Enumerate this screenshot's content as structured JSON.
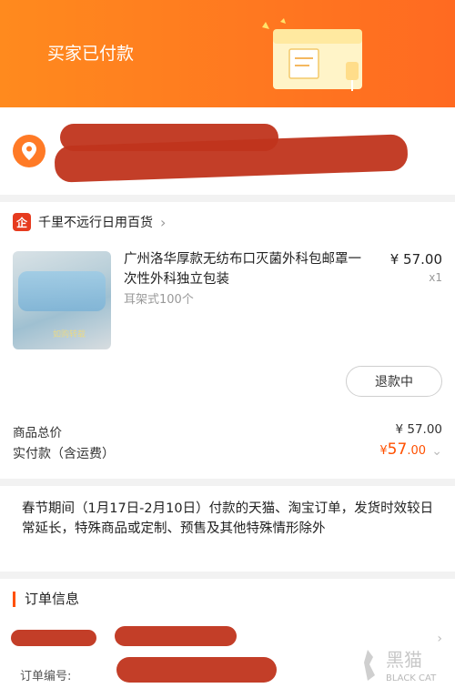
{
  "header": {
    "status_title": "买家已付款"
  },
  "shop": {
    "name": "千里不远行日用百货",
    "icon_text": "企"
  },
  "item": {
    "name": "广州洛华厚款无纺布口灭菌外科包邮罩一次性外科独立包装",
    "sku": "耳架式100个",
    "price": "¥ 57.00",
    "quantity": "x1",
    "thumbnail_watermark": "如购转载",
    "refund_button": "退款中"
  },
  "summary": {
    "goods_total_label": "商品总价",
    "goods_total_value": "¥ 57.00",
    "paid_label": "实付款（含运费）",
    "paid_currency": "¥",
    "paid_integer": "57",
    "paid_decimal": ".00"
  },
  "notice": "春节期间（1月17日-2月10日）付款的天猫、淘宝订单，发货时效较日常延长，特殊商品或定制、预售及其他特殊情形除外",
  "order": {
    "title": "订单信息",
    "order_no_label": "订单编号:"
  },
  "watermark": {
    "brand_cn": "黑猫",
    "brand_en": "BLACK CAT"
  },
  "colors": {
    "accent": "#ff5000",
    "header_start": "#ff8a1e",
    "header_end": "#ff6a21",
    "redaction": "#c0341c"
  }
}
